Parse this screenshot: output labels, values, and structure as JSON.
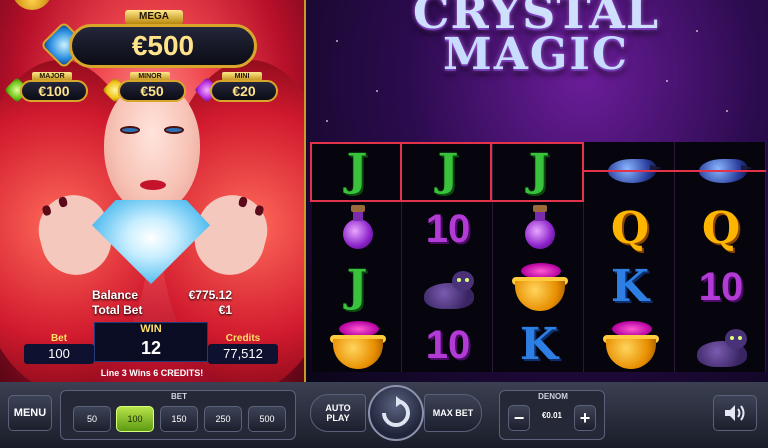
{
  "jackpots": {
    "mega": {
      "label": "MEGA",
      "value": "€500"
    },
    "major": {
      "label": "MAJOR",
      "value": "€100"
    },
    "minor": {
      "label": "MINOR",
      "value": "€50"
    },
    "mini": {
      "label": "MINI",
      "value": "€20"
    }
  },
  "game": {
    "title_line1": "CRYSTAL",
    "title_line2": "MAGIC"
  },
  "account": {
    "balance_label": "Balance",
    "balance_value": "€775.12",
    "total_bet_label": "Total Bet",
    "total_bet_value": "€1",
    "bet_label": "Bet",
    "bet_value": "100",
    "win_label": "WIN",
    "win_value": "12",
    "credits_label": "Credits",
    "credits_value": "77,512",
    "win_message": "Line 3 Wins 6 CREDITS!"
  },
  "reels": [
    [
      {
        "sym": "J",
        "type": "text"
      },
      {
        "sym": "potion",
        "type": "pic"
      },
      {
        "sym": "J",
        "type": "text"
      },
      {
        "sym": "cauldron",
        "type": "pic"
      }
    ],
    [
      {
        "sym": "J",
        "type": "text"
      },
      {
        "sym": "10",
        "type": "text"
      },
      {
        "sym": "cat",
        "type": "pic"
      },
      {
        "sym": "10",
        "type": "text"
      }
    ],
    [
      {
        "sym": "J",
        "type": "text"
      },
      {
        "sym": "potion",
        "type": "pic"
      },
      {
        "sym": "cauldron",
        "type": "pic"
      },
      {
        "sym": "K",
        "type": "text"
      }
    ],
    [
      {
        "sym": "crow",
        "type": "pic"
      },
      {
        "sym": "Q",
        "type": "text"
      },
      {
        "sym": "K",
        "type": "text"
      },
      {
        "sym": "cauldron",
        "type": "pic"
      }
    ],
    [
      {
        "sym": "crow",
        "type": "pic"
      },
      {
        "sym": "Q",
        "type": "text"
      },
      {
        "sym": "10",
        "type": "text"
      },
      {
        "sym": "cat",
        "type": "pic"
      }
    ]
  ],
  "controls": {
    "menu_label": "MENU",
    "bet_title": "BET",
    "bet_options": [
      "50",
      "100",
      "150",
      "250",
      "500"
    ],
    "bet_selected": "100",
    "auto_play_line1": "AUTO",
    "auto_play_line2": "PLAY",
    "max_bet_label": "MAX BET",
    "denom_title": "DENOM",
    "denom_value": "€0.01",
    "denom_minus": "−",
    "denom_plus": "+",
    "spin_icon": "spin-arrow-icon",
    "sound_icon": "speaker-icon"
  },
  "colors": {
    "accent_gold": "#d8a62a",
    "win_line": "#e2334a",
    "bet_active": "#8cc63f"
  }
}
